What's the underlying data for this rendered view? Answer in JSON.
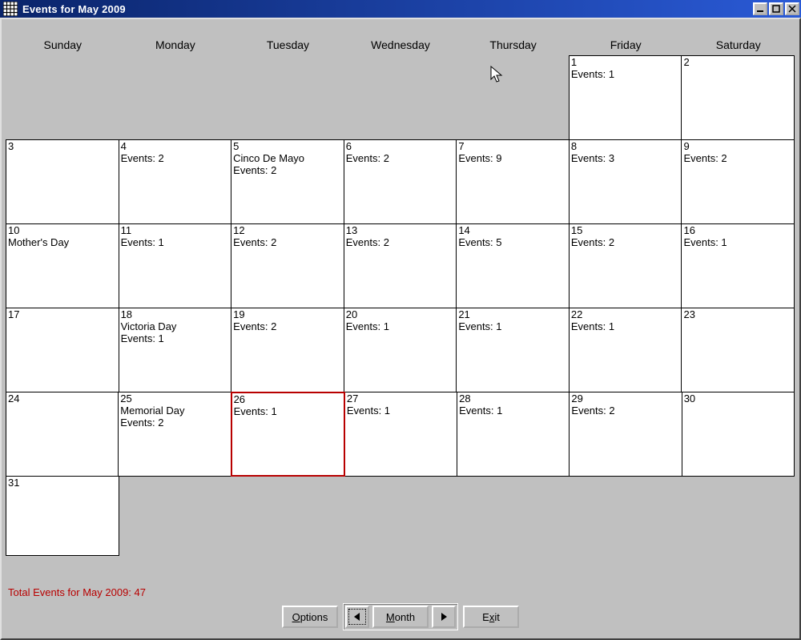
{
  "window": {
    "title": "Events for May 2009"
  },
  "weekdays": [
    "Sunday",
    "Monday",
    "Tuesday",
    "Wednesday",
    "Thursday",
    "Friday",
    "Saturday"
  ],
  "grid": [
    [
      {
        "empty": true
      },
      {
        "empty": true
      },
      {
        "empty": true
      },
      {
        "empty": true
      },
      {
        "empty": true
      },
      {
        "day": "1",
        "events": "Events: 1"
      },
      {
        "day": "2"
      }
    ],
    [
      {
        "day": "3"
      },
      {
        "day": "4",
        "events": "Events: 2"
      },
      {
        "day": "5",
        "holiday": "Cinco De Mayo",
        "events": "Events: 2"
      },
      {
        "day": "6",
        "events": "Events: 2"
      },
      {
        "day": "7",
        "events": "Events: 9"
      },
      {
        "day": "8",
        "events": "Events: 3"
      },
      {
        "day": "9",
        "events": "Events: 2"
      }
    ],
    [
      {
        "day": "10",
        "holiday": "Mother's Day"
      },
      {
        "day": "11",
        "events": "Events: 1"
      },
      {
        "day": "12",
        "events": "Events: 2"
      },
      {
        "day": "13",
        "events": "Events: 2"
      },
      {
        "day": "14",
        "events": "Events: 5"
      },
      {
        "day": "15",
        "events": "Events: 2"
      },
      {
        "day": "16",
        "events": "Events: 1"
      }
    ],
    [
      {
        "day": "17"
      },
      {
        "day": "18",
        "holiday": "Victoria Day",
        "events": "Events: 1"
      },
      {
        "day": "19",
        "events": "Events: 2"
      },
      {
        "day": "20",
        "events": "Events: 1"
      },
      {
        "day": "21",
        "events": "Events: 1"
      },
      {
        "day": "22",
        "events": "Events: 1"
      },
      {
        "day": "23"
      }
    ],
    [
      {
        "day": "24"
      },
      {
        "day": "25",
        "holiday": "Memorial Day",
        "events": "Events: 2"
      },
      {
        "day": "26",
        "events": "Events: 1",
        "today": true
      },
      {
        "day": "27",
        "events": "Events: 1"
      },
      {
        "day": "28",
        "events": "Events: 1"
      },
      {
        "day": "29",
        "events": "Events: 2"
      },
      {
        "day": "30"
      }
    ],
    [
      {
        "day": "31"
      },
      {
        "empty": true
      },
      {
        "empty": true
      },
      {
        "empty": true
      },
      {
        "empty": true
      },
      {
        "empty": true
      },
      {
        "empty": true
      }
    ]
  ],
  "summary": "Total  Events for May 2009: 47",
  "buttons": {
    "options": "Options",
    "month": "Month",
    "exit": "Exit"
  }
}
